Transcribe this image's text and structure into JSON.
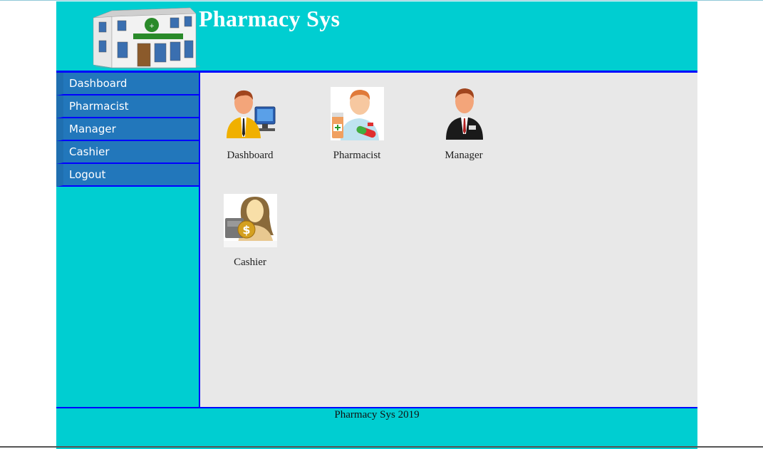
{
  "header": {
    "title": "Pharmacy Sys",
    "logo_icon": "pharmacy-building-icon"
  },
  "sidebar": {
    "items": [
      {
        "label": "Dashboard"
      },
      {
        "label": "Pharmacist"
      },
      {
        "label": "Manager"
      },
      {
        "label": "Cashier"
      },
      {
        "label": "Logout"
      }
    ]
  },
  "main": {
    "tiles": [
      {
        "label": "Dashboard",
        "icon": "user-computer-icon"
      },
      {
        "label": "Pharmacist",
        "icon": "pharmacist-icon"
      },
      {
        "label": "Manager",
        "icon": "manager-icon"
      },
      {
        "label": "Cashier",
        "icon": "cashier-icon"
      }
    ]
  },
  "footer": {
    "text": "Pharmacy Sys 2019"
  },
  "colors": {
    "header_bg": "#00ced1",
    "border": "#0000ff",
    "nav_bg": "#2277bb",
    "content_bg": "#e8e8e8"
  }
}
